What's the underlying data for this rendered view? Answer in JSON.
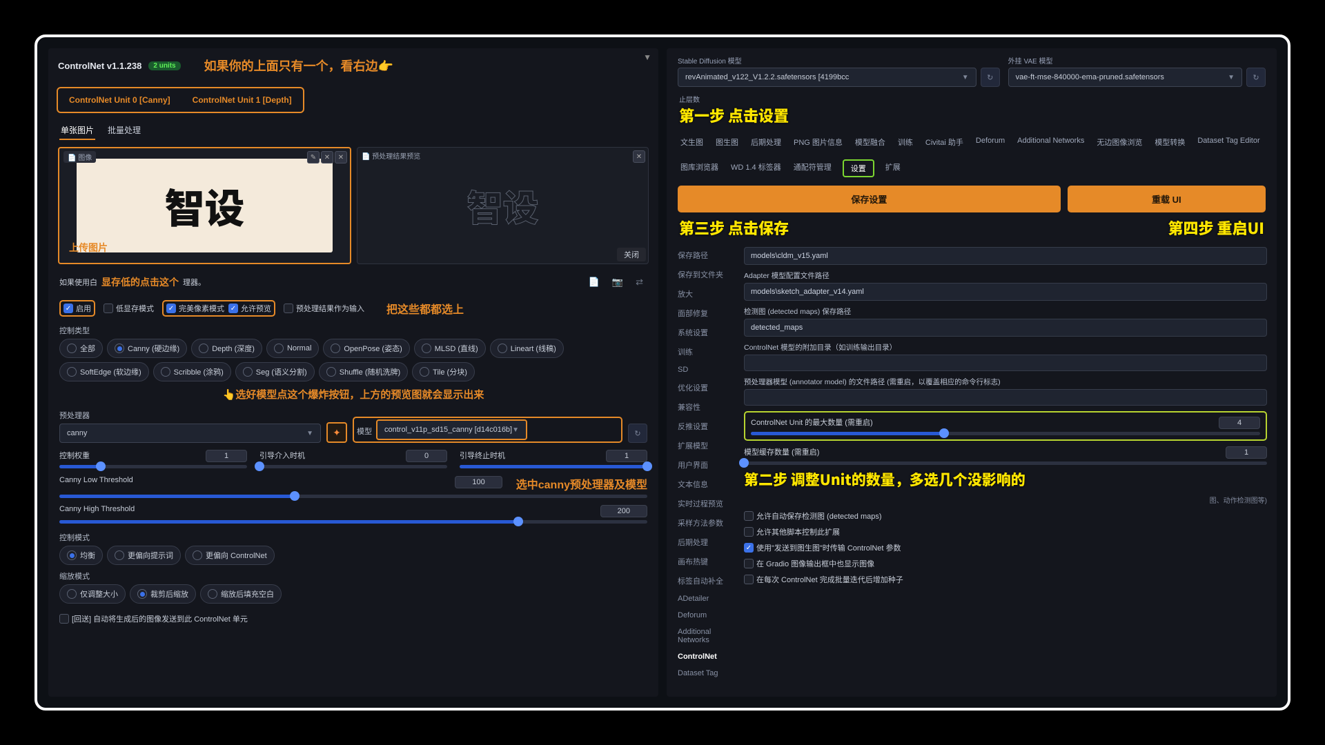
{
  "left": {
    "title": "ControlNet v1.1.238",
    "units_badge": "2 units",
    "annotation_top": "如果你的上面只有一个，看右边👉",
    "tabs": [
      "ControlNet Unit 0 [Canny]",
      "ControlNet Unit 1 [Depth]"
    ],
    "subtabs": {
      "single": "单张图片",
      "batch": "批量处理"
    },
    "image_label": "图像",
    "source_text": "智设",
    "preview_label": "📄 预处理结果预览",
    "close_btn": "关闭",
    "ann_upload": "上传图片",
    "note1_prefix": "如果使用白",
    "ann_vram": "显存低的点击这个",
    "note1_suffix": "理器。",
    "checks": {
      "enable": "启用",
      "lowvram": "低显存模式",
      "pixel": "完美像素模式",
      "preview": "允许预览",
      "asinput": "预处理结果作为输入"
    },
    "ann_check": "把这些都都选上",
    "control_type_label": "控制类型",
    "types": [
      {
        "t": "全部",
        "on": false
      },
      {
        "t": "Canny (硬边缘)",
        "on": true
      },
      {
        "t": "Depth (深度)",
        "on": false
      },
      {
        "t": "Normal",
        "on": false
      },
      {
        "t": "OpenPose (姿态)",
        "on": false
      },
      {
        "t": "MLSD (直线)",
        "on": false
      },
      {
        "t": "Lineart (线稿)",
        "on": false
      },
      {
        "t": "SoftEdge (软边缘)",
        "on": false
      },
      {
        "t": "Scribble (涂鸦)",
        "on": false
      },
      {
        "t": "Seg (语义分割)",
        "on": false
      },
      {
        "t": "Shuffle (随机洗牌)",
        "on": false
      },
      {
        "t": "Tile (分块)",
        "on": false
      }
    ],
    "ann_explode": "👆选好模型点这个爆炸按钮，上方的预览图就会显示出来",
    "prep_label": "预处理器",
    "prep_val": "canny",
    "model_label": "模型",
    "model_val": "control_v11p_sd15_canny [d14c016b]",
    "sliders": {
      "weight": {
        "l": "控制权重",
        "v": "1",
        "pct": 22
      },
      "start": {
        "l": "引导介入时机",
        "v": "0",
        "pct": 0
      },
      "end": {
        "l": "引导终止时机",
        "v": "1",
        "pct": 100
      },
      "low": {
        "l": "Canny Low Threshold",
        "v": "100",
        "pct": 40
      },
      "high": {
        "l": "Canny High Threshold",
        "v": "200",
        "pct": 78
      }
    },
    "ann_canny": "选中canny预处理器及模型",
    "ctrl_mode_label": "控制模式",
    "ctrl_modes": [
      {
        "t": "均衡",
        "on": true
      },
      {
        "t": "更偏向提示词",
        "on": false
      },
      {
        "t": "更偏向 ControlNet",
        "on": false
      }
    ],
    "resize_label": "缩放模式",
    "resize_modes": [
      {
        "t": "仅调整大小",
        "on": false
      },
      {
        "t": "裁剪后缩放",
        "on": true
      },
      {
        "t": "缩放后填充空白",
        "on": false
      }
    ],
    "loopback": "[回送] 自动将生成后的图像发送到此 ControlNet 单元"
  },
  "right": {
    "sd_label": "Stable Diffusion 模型",
    "sd_val": "revAnimated_v122_V1.2.2.safetensors [4199bcc",
    "vae_label": "外挂 VAE 模型",
    "vae_val": "vae-ft-mse-840000-ema-pruned.safetensors",
    "clip_label": "止层数",
    "step1": "第一步 点击设置",
    "navtabs": [
      "文生图",
      "图生图",
      "后期处理",
      "PNG 图片信息",
      "模型融合",
      "训练",
      "Civitai 助手",
      "Deforum",
      "Additional Networks",
      "无边图像浏览",
      "模型转换",
      "Dataset Tag Editor",
      "图库浏览器",
      "WD 1.4 标签器",
      "通配符管理"
    ],
    "settings": "设置",
    "extensions": "扩展",
    "save_btn": "保存设置",
    "reload_btn": "重载 UI",
    "step3": "第三步 点击保存",
    "step4": "第四步 重启UI",
    "sidebar": [
      "保存路径",
      "保存到文件夹",
      "放大",
      "面部修复",
      "系统设置",
      "训练",
      "SD",
      "优化设置",
      "兼容性",
      "反推设置",
      "扩展模型",
      "用户界面",
      "文本信息",
      "实时过程预览",
      "采样方法参数",
      "后期处理",
      "画布热键",
      "标签自动补全",
      "ADetailer",
      "Deforum",
      "Additional Networks",
      "ControlNet",
      "Dataset Tag"
    ],
    "cfg": {
      "cldm": {
        "l": "",
        "v": "models\\cldm_v15.yaml"
      },
      "adapter": {
        "l": "Adapter 模型配置文件路径",
        "v": "models\\sketch_adapter_v14.yaml"
      },
      "detected": {
        "l": "检测图 (detected maps) 保存路径",
        "v": "detected_maps"
      },
      "extra": {
        "l": "ControlNet 模型的附加目录（如训练输出目录）",
        "v": ""
      },
      "annot": {
        "l": "预处理器模型 (annotator model) 的文件路径 (需重启，以覆盖相应的命令行标志)",
        "v": ""
      }
    },
    "unit_max": {
      "l": "ControlNet Unit 的最大数量 (需重启)",
      "v": "4",
      "pct": 38
    },
    "cache": {
      "l": "模型缓存数量 (需重启)",
      "v": "1",
      "pct": 0
    },
    "step2": "第二步 调整Unit的数量，多选几个没影响的",
    "cfg_sub": "图、动作检测图等)",
    "cfg_checks": [
      {
        "t": "允许自动保存检测图 (detected maps)",
        "on": false
      },
      {
        "t": "允许其他脚本控制此扩展",
        "on": false
      },
      {
        "t": "使用\"发送到图生图\"时传输 ControlNet 参数",
        "on": true
      },
      {
        "t": "在 Gradio 图像输出框中也显示图像",
        "on": false
      },
      {
        "t": "在每次 ControlNet 完成批量迭代后增加种子",
        "on": false
      }
    ]
  }
}
